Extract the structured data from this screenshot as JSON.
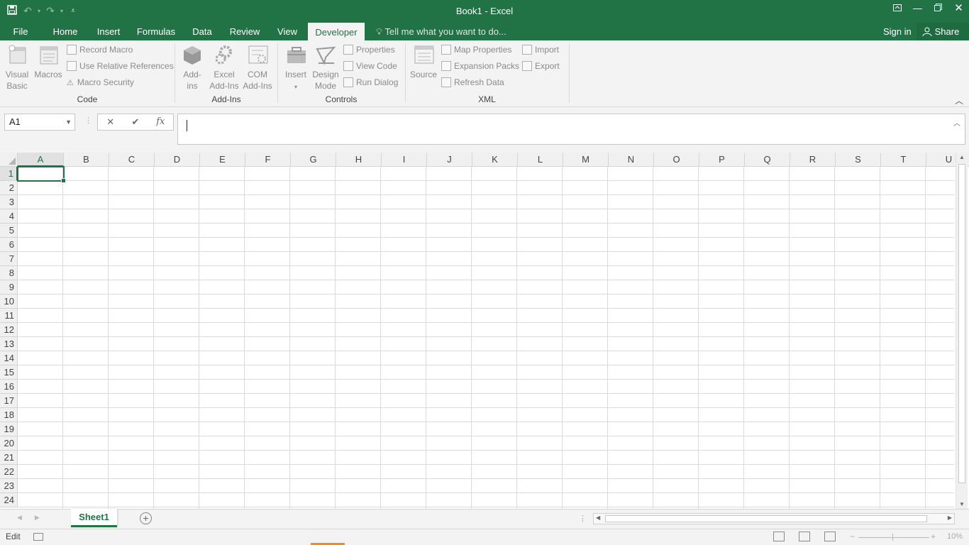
{
  "app": {
    "title": "Book1 - Excel"
  },
  "qat": {
    "save_icon": "save-icon",
    "undo_icon": "undo-icon",
    "redo_icon": "redo-icon",
    "customize_icon": "customize-qat-icon"
  },
  "window_controls": {
    "ribbon_display": "ribbon-display-options-icon",
    "minimize": "minimize-icon",
    "restore": "restore-icon",
    "close": "close-icon"
  },
  "tabs": [
    "File",
    "Home",
    "Insert",
    "Formulas",
    "Data",
    "Review",
    "View",
    "Developer"
  ],
  "active_tab": "Developer",
  "tell_me": "Tell me what you want to do...",
  "sign_in": "Sign in",
  "share": "Share",
  "ribbon": {
    "code": {
      "label": "Code",
      "visual_basic": [
        "Visual",
        "Basic"
      ],
      "macros": "Macros",
      "record_macro": "Record Macro",
      "use_relative": "Use Relative References",
      "macro_security": "Macro Security"
    },
    "addins": {
      "label": "Add-Ins",
      "addins": [
        "Add-",
        "ins"
      ],
      "excel_addins": [
        "Excel",
        "Add-Ins"
      ],
      "com_addins": [
        "COM",
        "Add-Ins"
      ]
    },
    "controls": {
      "label": "Controls",
      "insert": "Insert",
      "design_mode": [
        "Design",
        "Mode"
      ],
      "properties": "Properties",
      "view_code": "View Code",
      "run_dialog": "Run Dialog"
    },
    "xml": {
      "label": "XML",
      "source": "Source",
      "map_properties": "Map Properties",
      "expansion_packs": "Expansion Packs",
      "refresh_data": "Refresh Data",
      "import": "Import",
      "export": "Export"
    }
  },
  "formula_bar": {
    "name_box": "A1",
    "cancel": "✕",
    "enter": "✔",
    "fx": "fx",
    "value": ""
  },
  "grid": {
    "columns": [
      "A",
      "B",
      "C",
      "D",
      "E",
      "F",
      "G",
      "H",
      "I",
      "J",
      "K",
      "L",
      "M",
      "N",
      "O",
      "P",
      "Q",
      "R",
      "S",
      "T",
      "U"
    ],
    "rows": [
      "1",
      "2",
      "3",
      "4",
      "5",
      "6",
      "7",
      "8",
      "9",
      "10",
      "11",
      "12",
      "13",
      "14",
      "15",
      "16",
      "17",
      "18",
      "19",
      "20",
      "21",
      "22",
      "23",
      "24"
    ],
    "active_cell": "A1"
  },
  "sheets": {
    "tabs": [
      "Sheet1"
    ],
    "active": "Sheet1",
    "add_icon": "add-sheet-icon"
  },
  "status": {
    "mode": "Edit",
    "zoom": "10%"
  },
  "colors": {
    "accent": "#217346",
    "ribbon_bg": "#f3f3f3"
  }
}
